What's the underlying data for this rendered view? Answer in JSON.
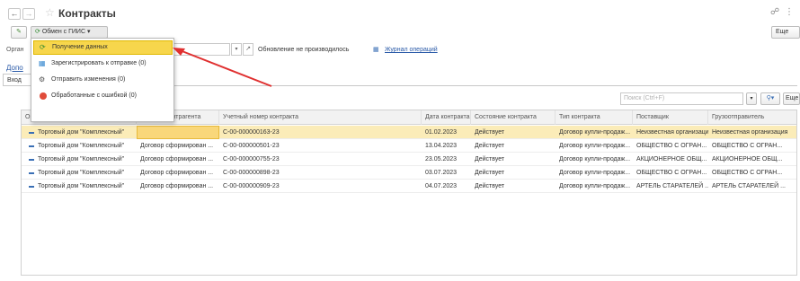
{
  "window": {
    "title": "Контракты",
    "top_icons": {
      "link": "☍",
      "more": "⋮"
    }
  },
  "toolbar": {
    "exchange_button": "Обмен с ГИИС",
    "more_button": "Еще"
  },
  "filter": {
    "org_label_partial": "Орган",
    "status_text": "Обновление не производилось",
    "journal_link": "Журнал операций",
    "addl_link_partial": "Допо",
    "tab_partial": "Вход"
  },
  "menu": {
    "items": [
      {
        "label": "Получение данных",
        "icon": "refresh-icon",
        "highlighted": true
      },
      {
        "label": "Зарегистрировать к отправке (0)",
        "icon": "register-icon"
      },
      {
        "label": "Отправить изменения (0)",
        "icon": "send-icon"
      },
      {
        "label": "Обработанные с ошибкой (0)",
        "icon": "error-icon"
      }
    ]
  },
  "list_toolbar": {
    "search_placeholder": "Поиск (Ctrl+F)",
    "more_button": "Еще"
  },
  "table": {
    "columns": [
      "Организация",
      "Договор контрагента",
      "Учетный номер контракта",
      "Дата контракта",
      "Состояние контракта",
      "Тип контракта",
      "Поставщик",
      "Грузоотправитель"
    ],
    "rows": [
      [
        "Торговый дом \"Комплексный\"",
        "",
        "С-00-000000163-23",
        "01.02.2023",
        "Действует",
        "Договор купли-продаж...",
        "Неизвестная организация",
        "Неизвестная организация"
      ],
      [
        "Торговый дом \"Комплексный\"",
        "Договор сформирован ...",
        "С-00-000000501-23",
        "13.04.2023",
        "Действует",
        "Договор купли-продаж...",
        "ОБЩЕСТВО С ОГРАН...",
        "ОБЩЕСТВО С ОГРАН..."
      ],
      [
        "Торговый дом \"Комплексный\"",
        "Договор сформирован ...",
        "С-00-000000755-23",
        "23.05.2023",
        "Действует",
        "Договор купли-продаж...",
        "АКЦИОНЕРНОЕ ОБЩ...",
        "АКЦИОНЕРНОЕ ОБЩ..."
      ],
      [
        "Торговый дом \"Комплексный\"",
        "Договор сформирован ...",
        "С-00-000000898-23",
        "03.07.2023",
        "Действует",
        "Договор купли-продаж...",
        "ОБЩЕСТВО С ОГРАН...",
        "ОБЩЕСТВО С ОГРАН..."
      ],
      [
        "Торговый дом \"Комплексный\"",
        "Договор сформирован ...",
        "С-00-000000909-23",
        "04.07.2023",
        "Действует",
        "Договор купли-продаж...",
        "АРТЕЛЬ СТАРАТЕЛЕЙ ...",
        "АРТЕЛЬ СТАРАТЕЛЕЙ ..."
      ]
    ],
    "selected_row": 0
  },
  "colors": {
    "highlight": "#f7d64c",
    "selected_row": "#fbecb8",
    "arrow": "#e03030",
    "link": "#2a5aa8"
  }
}
